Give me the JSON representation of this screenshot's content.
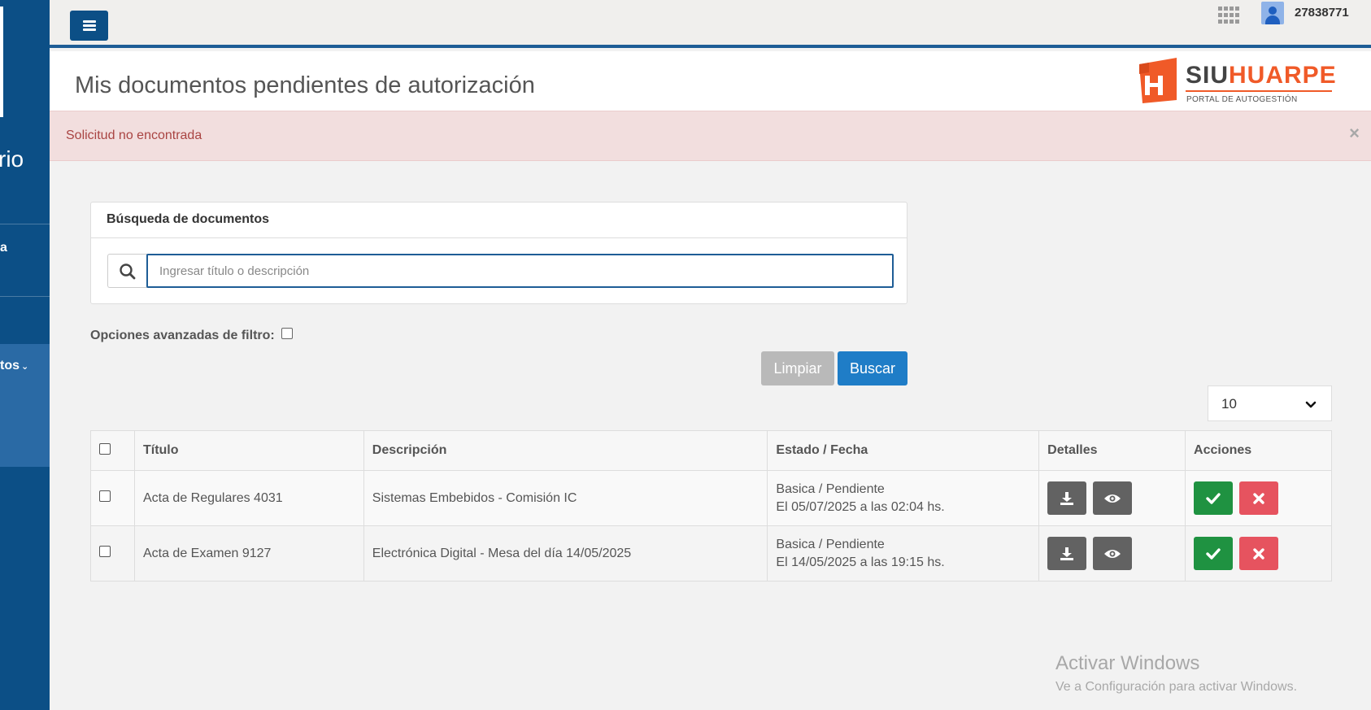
{
  "sidebar": {
    "user_fragment": "rio",
    "item_fragment_1": "a",
    "item_fragment_active": "tos"
  },
  "topbar": {
    "username": "27838771",
    "menu_icon": "hamburger-icon",
    "apps_icon": "grid-icon",
    "avatar_icon": "user-avatar-icon"
  },
  "header": {
    "title": "Mis documentos pendientes de autorización",
    "brand_siu": "SIU",
    "brand_huarpe": "HUARPE",
    "brand_subtitle": "PORTAL DE AUTOGESTIÓN"
  },
  "alert": {
    "message": "Solicitud no encontrada",
    "close": "×"
  },
  "search": {
    "panel_title": "Búsqueda de documentos",
    "placeholder": "Ingresar título o descripción",
    "value": ""
  },
  "filters": {
    "advanced_label": "Opciones avanzadas de filtro:"
  },
  "buttons": {
    "clear": "Limpiar",
    "search": "Buscar"
  },
  "page_size": "10",
  "table": {
    "headers": [
      "Título",
      "Descripción",
      "Estado / Fecha",
      "Detalles",
      "Acciones"
    ],
    "rows": [
      {
        "titulo": "Acta de Regulares 4031",
        "descripcion": "Sistemas Embebidos - Comisión IC",
        "estado": "Basica / Pendiente",
        "fecha": "El 05/07/2025 a las 02:04 hs."
      },
      {
        "titulo": "Acta de Examen 9127",
        "descripcion": "Electrónica Digital - Mesa del día 14/05/2025",
        "estado": "Basica / Pendiente",
        "fecha": "El 14/05/2025 a las 19:15 hs."
      }
    ]
  },
  "watermark": {
    "line1": "Activar Windows",
    "line2": "Ve a Configuración para activar Windows."
  },
  "colors": {
    "sidebar": "#0c4f86",
    "brand_orange": "#f05a28",
    "primary_button": "#1f7dc7",
    "approve": "#1f9241",
    "reject": "#e6535f",
    "alert_bg": "#f2dede",
    "alert_text": "#a94442"
  }
}
